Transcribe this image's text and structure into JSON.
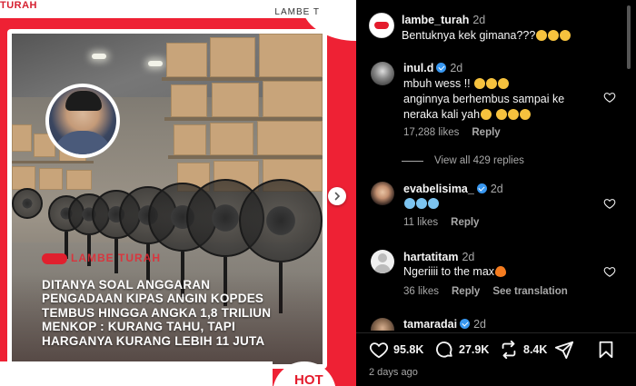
{
  "post": {
    "brand_top_left": "TURAH",
    "brand_top_right": "LAMBE T",
    "watermark": "LAMBE TURAH",
    "headline_lines": [
      "DITANYA SOAL ANGGARAN",
      "PENGADAAN KIPAS ANGIN KOPDES",
      "TEMBUS HINGGA ANGKA 1,8 TRILIUN",
      "MENKOP : KURANG TAHU, TAPI",
      "HARGANYA KURANG LEBIH 11 JUTA"
    ],
    "badge": "HOT",
    "colors": {
      "brand_red": "#e41b2c"
    }
  },
  "caption": {
    "username": "lambe_turah",
    "time": "2d",
    "text": "Bentuknya kek gimana???",
    "emoji_count": 3
  },
  "comments": [
    {
      "username": "inul.d",
      "verified": true,
      "time": "2d",
      "lines": [
        "mbuh wess !!",
        "anginnya berhembus sampai ke",
        "neraka kali yah"
      ],
      "likes": "17,288 likes",
      "reply": "Reply"
    },
    {
      "username": "evabelisima_",
      "verified": true,
      "time": "2d",
      "lines": [
        ""
      ],
      "likes": "11 likes",
      "reply": "Reply"
    },
    {
      "username": "hartatitam",
      "verified": false,
      "time": "2d",
      "lines": [
        "Ngeriiii to the max"
      ],
      "likes": "36 likes",
      "reply": "Reply",
      "see_translation": "See translation"
    },
    {
      "username": "tamaradai",
      "verified": true,
      "time": "2d"
    }
  ],
  "view_all": "View all 429 replies",
  "actions": {
    "likes": "95.8K",
    "comments": "27.9K",
    "reposts": "8.4K"
  },
  "posted": "2 days ago",
  "icons": [
    "heart-icon",
    "comment-icon",
    "repost-icon",
    "share-icon",
    "bookmark-icon",
    "chevron-right-icon"
  ]
}
